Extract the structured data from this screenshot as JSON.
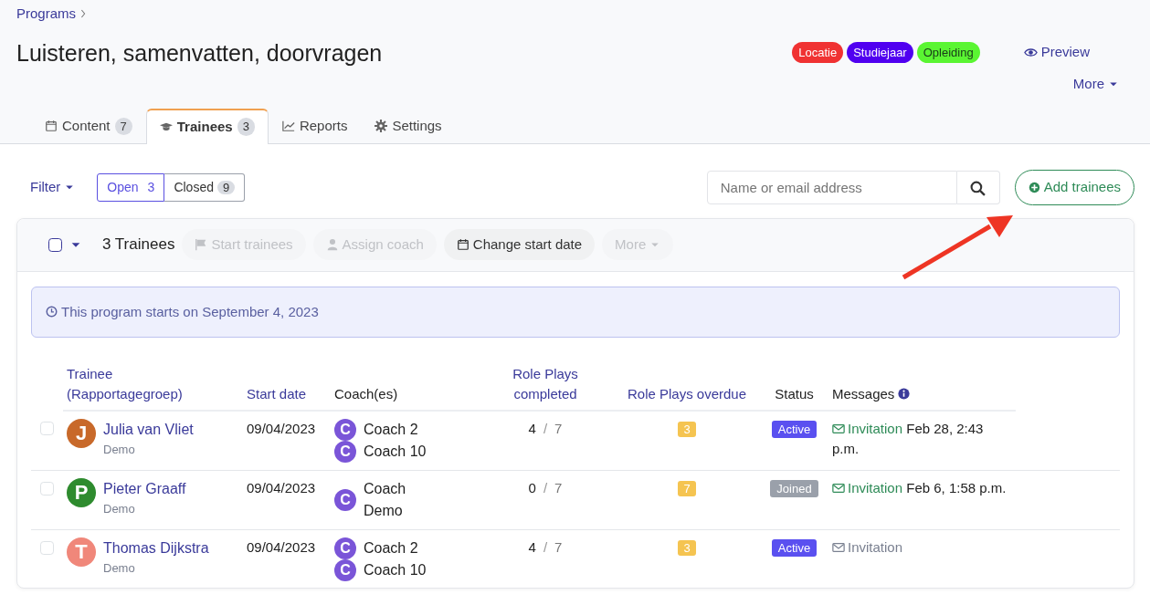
{
  "breadcrumb": {
    "label": "Programs"
  },
  "title": "Luisteren, samenvatten, doorvragen",
  "tags": [
    {
      "label": "Locatie",
      "color": "#f03232"
    },
    {
      "label": "Studiejaar",
      "color": "#5000f0"
    },
    {
      "label": "Opleiding",
      "color": "#5af532"
    }
  ],
  "preview": "Preview",
  "more_menu": "More",
  "tabs": [
    {
      "label": "Content",
      "count": "7",
      "kind": "calendar",
      "selected": false
    },
    {
      "label": "Trainees",
      "count": "3",
      "kind": "cap",
      "selected": true
    },
    {
      "label": "Reports",
      "kind": "chart",
      "selected": false
    },
    {
      "label": "Settings",
      "kind": "gear",
      "selected": false
    }
  ],
  "filter": "Filter",
  "segments": [
    {
      "label": "Open",
      "count": "3",
      "selected": true
    },
    {
      "label": "Closed",
      "count": "9",
      "selected": false
    }
  ],
  "search": {
    "placeholder": "Name or email address"
  },
  "add_button": "Add trainees",
  "toolbar": {
    "select_all": {
      "checked": false
    },
    "count": "3 Trainees",
    "actions": [
      {
        "label": "Start trainees",
        "kind": "flag",
        "disabled": true
      },
      {
        "label": "Assign coach",
        "kind": "user",
        "disabled": true
      },
      {
        "label": "Change start date",
        "kind": "calendar",
        "disabled": false
      },
      {
        "label": "More",
        "kind": "caret",
        "disabled": true
      }
    ]
  },
  "notice": "This program starts on September 4, 2023",
  "table": {
    "columns": [
      {
        "label": "Trainee (Rapportagegroep)",
        "sortable": true
      },
      {
        "label": "Start date",
        "sortable": true
      },
      {
        "label": "Coach(es)",
        "sortable": false
      },
      {
        "label": "Role Plays completed",
        "sortable": true
      },
      {
        "label": "Role Plays overdue",
        "sortable": true
      },
      {
        "label": "Status",
        "sortable": false
      },
      {
        "label": "Messages",
        "sortable": false,
        "info": true
      }
    ],
    "rows": [
      {
        "checked": false,
        "initial": "J",
        "color": "#c8692a",
        "name": "Julia van Vliet",
        "group": "Demo",
        "start_date": "09/04/2023",
        "coaches": [
          {
            "initial": "C",
            "name": "Coach 2"
          },
          {
            "initial": "C",
            "name": "Coach 10"
          }
        ],
        "completed": "4",
        "separator": "/",
        "total": "7",
        "overdue": "3",
        "status": {
          "label": "Active",
          "kind": "active"
        },
        "message": {
          "label": "Invitation",
          "sent": true,
          "time": "Feb 28, 2:43 p.m."
        }
      },
      {
        "checked": false,
        "initial": "P",
        "color": "#2e8b2e",
        "name": "Pieter Graaff",
        "group": "Demo",
        "start_date": "09/04/2023",
        "coaches": [
          {
            "initial": "C",
            "name": "Coach Demo"
          }
        ],
        "completed": "0",
        "separator": "/",
        "total": "7",
        "overdue": "7",
        "status": {
          "label": "Joined",
          "kind": "joined"
        },
        "message": {
          "label": "Invitation",
          "sent": true,
          "time": "Feb 6, 1:58 p.m."
        }
      },
      {
        "checked": false,
        "initial": "T",
        "color": "#f0877a",
        "name": "Thomas Dijkstra",
        "group": "Demo",
        "start_date": "09/04/2023",
        "coaches": [
          {
            "initial": "C",
            "name": "Coach 2"
          },
          {
            "initial": "C",
            "name": "Coach 10"
          }
        ],
        "completed": "4",
        "separator": "/",
        "total": "7",
        "overdue": "3",
        "status": {
          "label": "Active",
          "kind": "active"
        },
        "message": {
          "label": "Invitation",
          "sent": false
        }
      }
    ]
  }
}
